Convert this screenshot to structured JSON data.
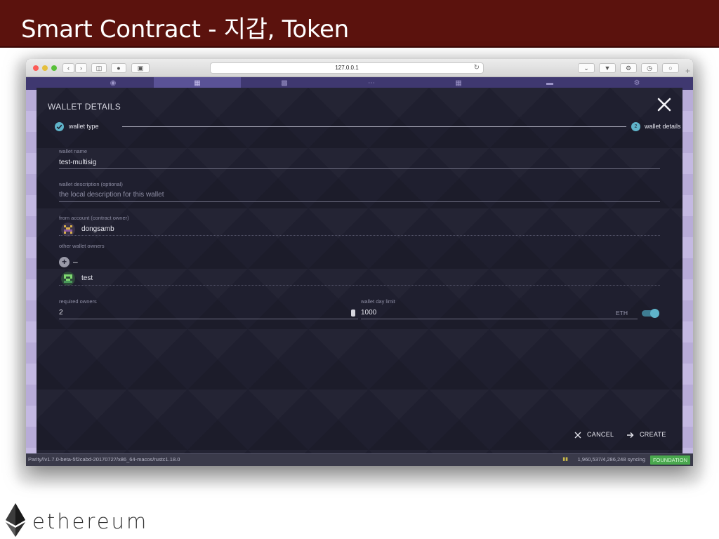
{
  "slide": {
    "title": "Smart Contract  -  지갑, Token",
    "brand": "ethereum",
    "header_color": "#5b120d"
  },
  "browser": {
    "url": "127.0.0.1",
    "icons": [
      "back-icon",
      "forward-icon",
      "sidebar-icon",
      "extension-icon",
      "share-icon",
      "reload-icon",
      "pocket-icon",
      "download-icon",
      "settings-icon",
      "history-icon",
      "circle-icon",
      "new-tab-icon"
    ]
  },
  "app": {
    "tabs": [
      "accounts",
      "addresses",
      "contracts",
      "apps",
      "signer",
      "status",
      "settings"
    ]
  },
  "modal": {
    "title": "WALLET DETAILS",
    "steps": [
      {
        "label": "wallet type",
        "state": "done"
      },
      {
        "label": "wallet details",
        "number": "2",
        "state": "active"
      }
    ],
    "fields": {
      "wallet_name": {
        "label": "wallet name",
        "value": "test-multisig"
      },
      "wallet_description": {
        "label": "wallet description (optional)",
        "placeholder": "the local description for this wallet"
      },
      "from_account": {
        "label": "from account (contract owner)",
        "value": "dongsamb"
      },
      "other_owners": {
        "label": "other wallet owners",
        "add": "+",
        "remove": "–",
        "owners": [
          "test"
        ]
      },
      "required_owners": {
        "label": "required owners",
        "value": "2"
      },
      "day_limit": {
        "label": "wallet day limit",
        "value": "1000",
        "unit": "ETH",
        "enabled": true
      }
    },
    "actions": {
      "cancel": "CANCEL",
      "create": "CREATE"
    }
  },
  "status_bar": {
    "version": "Parity//v1.7.0-beta-5f2cabd-20170727/x86_64-macos/rustc1.18.0",
    "sync": "1,960,537/4,286,248 syncing",
    "chain": "FOUNDATION"
  },
  "colors": {
    "accent": "#5fb3c9",
    "modal_bg": "#1f1f2f",
    "app_bg": "#b8acd8",
    "badge": "#4aa84e"
  }
}
